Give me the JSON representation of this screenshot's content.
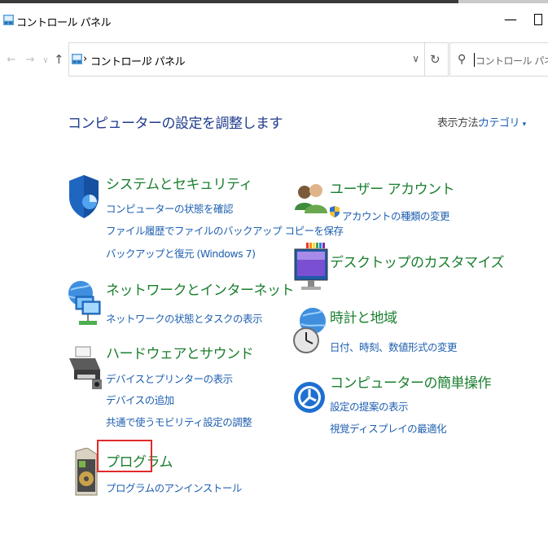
{
  "window": {
    "title": "コントロール パネル"
  },
  "address_bar": {
    "breadcrumb": [
      "コントロール パネル"
    ],
    "search_placeholder": "コントロール パネルの検索"
  },
  "page": {
    "heading": "コンピューターの設定を調整します",
    "view_by_label": "表示方法:",
    "view_by_value": "カテゴリ"
  },
  "categories": [
    {
      "title": "システムとセキュリティ",
      "icon": "shield-icon",
      "links": [
        "コンピューターの状態を確認",
        "ファイル履歴でファイルのバックアップ コピーを保存",
        "バックアップと復元 (Windows 7)"
      ]
    },
    {
      "title": "ネットワークとインターネット",
      "icon": "network-icon",
      "links": [
        "ネットワークの状態とタスクの表示"
      ]
    },
    {
      "title": "ハードウェアとサウンド",
      "icon": "printer-icon",
      "links": [
        "デバイスとプリンターの表示",
        "デバイスの追加",
        "共通で使うモビリティ設定の調整"
      ]
    },
    {
      "title": "プログラム",
      "icon": "programs-icon",
      "links": [
        "プログラムのアンインストール"
      ]
    },
    {
      "title": "ユーザー アカウント",
      "icon": "users-icon",
      "links": [
        "アカウントの種類の変更"
      ]
    },
    {
      "title": "デスクトップのカスタマイズ",
      "icon": "monitor-icon",
      "links": []
    },
    {
      "title": "時計と地域",
      "icon": "clock-globe-icon",
      "links": [
        "日付、時刻、数値形式の変更"
      ]
    },
    {
      "title": "コンピューターの簡単操作",
      "icon": "ease-of-access-icon",
      "links": [
        "設定の提案の表示",
        "視覚ディスプレイの最適化"
      ]
    }
  ],
  "colors": {
    "category_title": "#1a7f2e",
    "link": "#1e5fb0",
    "heading": "#1e3b8c",
    "highlight": "#e12a2a"
  }
}
